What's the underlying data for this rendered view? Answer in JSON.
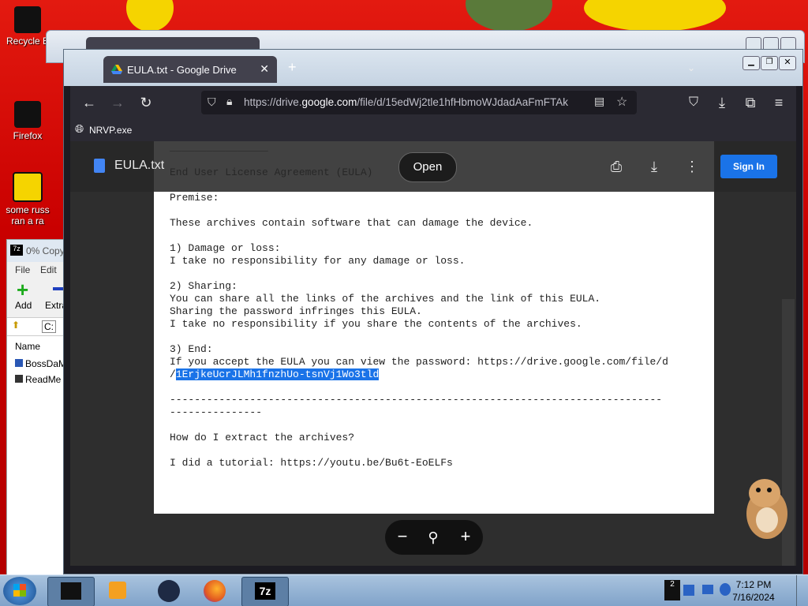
{
  "desktop": {
    "icons": [
      {
        "label": "Recycle B",
        "icon": "recycle-bin-icon"
      },
      {
        "label": "Firefox",
        "icon": "firefox-icon"
      },
      {
        "label": "some russ ran a ra",
        "icon": "exe-file-icon"
      }
    ]
  },
  "zip_window": {
    "title": "0% Copy",
    "menu": [
      "File",
      "Edit"
    ],
    "toolbar": [
      "Add",
      "Extra"
    ],
    "path": "C:",
    "column": "Name",
    "files": [
      "BossDaM",
      "ReadMe"
    ]
  },
  "browser": {
    "tab_title": "EULA.txt - Google Drive",
    "url_prefix": "https://drive.",
    "url_domain": "google.com",
    "url_rest": "/file/d/15edWj2tle1hfHbmoWJdadAaFmFTAk",
    "bookmark": "NRVP.exe"
  },
  "drive": {
    "file_name": "EULA.txt",
    "open_label": "Open",
    "signin_label": "Sign In",
    "doc_lines": [
      "________________",
      "",
      "End User License Agreement (EULA)",
      "",
      "Premise:",
      "",
      "These archives contain software that can damage the device.",
      "",
      "1) Damage or loss:",
      "I take no responsibility for any damage or loss.",
      "",
      "2) Sharing:",
      "You can share all the links of the archives and the link of this EULA.",
      "Sharing the password infringes this EULA.",
      "I take no responsibility if you share the contents of the archives.",
      "",
      "3) End:",
      "If you accept the EULA you can view the password: https://drive.google.com/file/d",
      "/",
      "",
      "--------------------------------------------------------------------------------",
      "---------------",
      "",
      "How do I extract the archives?",
      "",
      "I did a tutorial: https://youtu.be/Bu6t-EoELFs"
    ],
    "highlighted": "1ErjkeUcrJLMh1fnzhUo-tsnVj1Wo3tld"
  },
  "taskbar": {
    "time": "7:12 PM",
    "date": "7/16/2024",
    "tray_count": "2"
  },
  "colors": {
    "accent": "#1a73e8",
    "desktop_red": "#d10000",
    "browser_dark": "#1c1b22"
  }
}
